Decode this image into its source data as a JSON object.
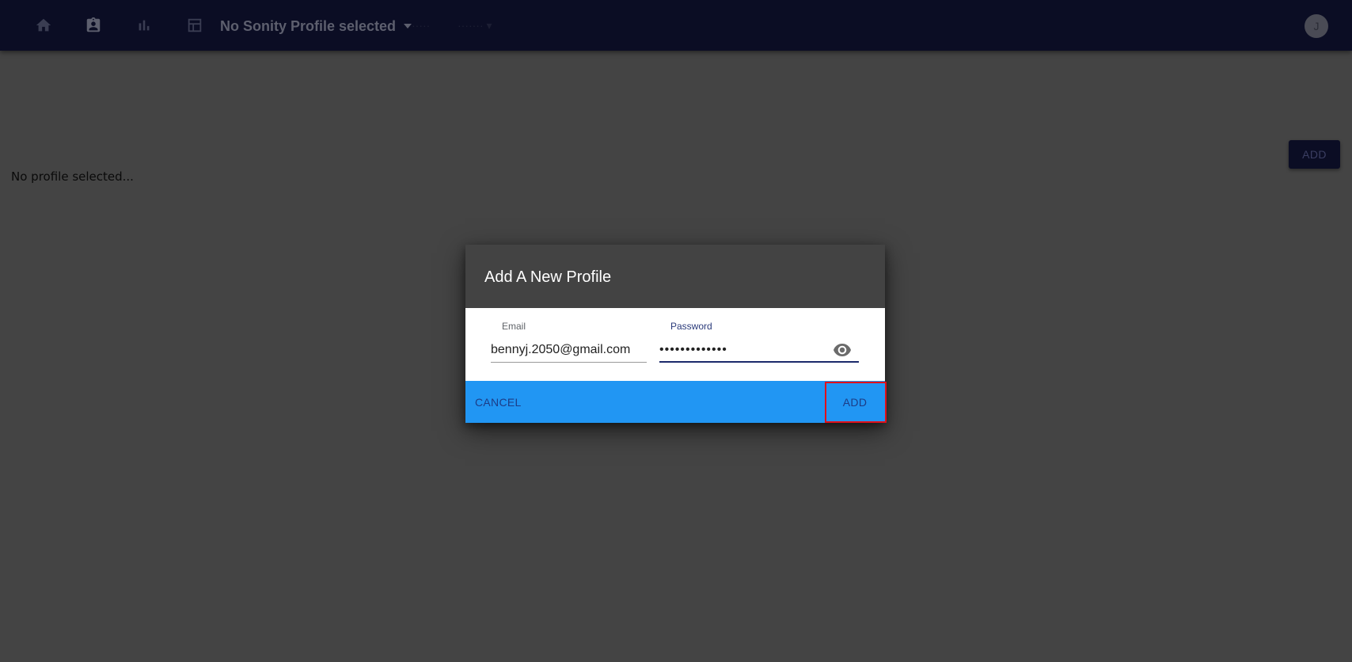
{
  "appbar": {
    "icons": [
      "home-icon",
      "assignment-ind-icon",
      "bar-chart-icon",
      "table-icon"
    ],
    "profile_selector": "No Sonity Profile selected",
    "avatar_initial": "J",
    "background_color": "#0b0d24"
  },
  "page": {
    "add_label": "ADD",
    "no_profile_text": "No profile selected..."
  },
  "dialog": {
    "title": "Add A New Profile",
    "email_label": "Email",
    "email_value": "bennyj.2050@gmail.com",
    "password_label": "Password",
    "password_value": "•••••••••••••",
    "cancel_label": "CANCEL",
    "add_label": "ADD",
    "footer_color": "#2196f3"
  }
}
